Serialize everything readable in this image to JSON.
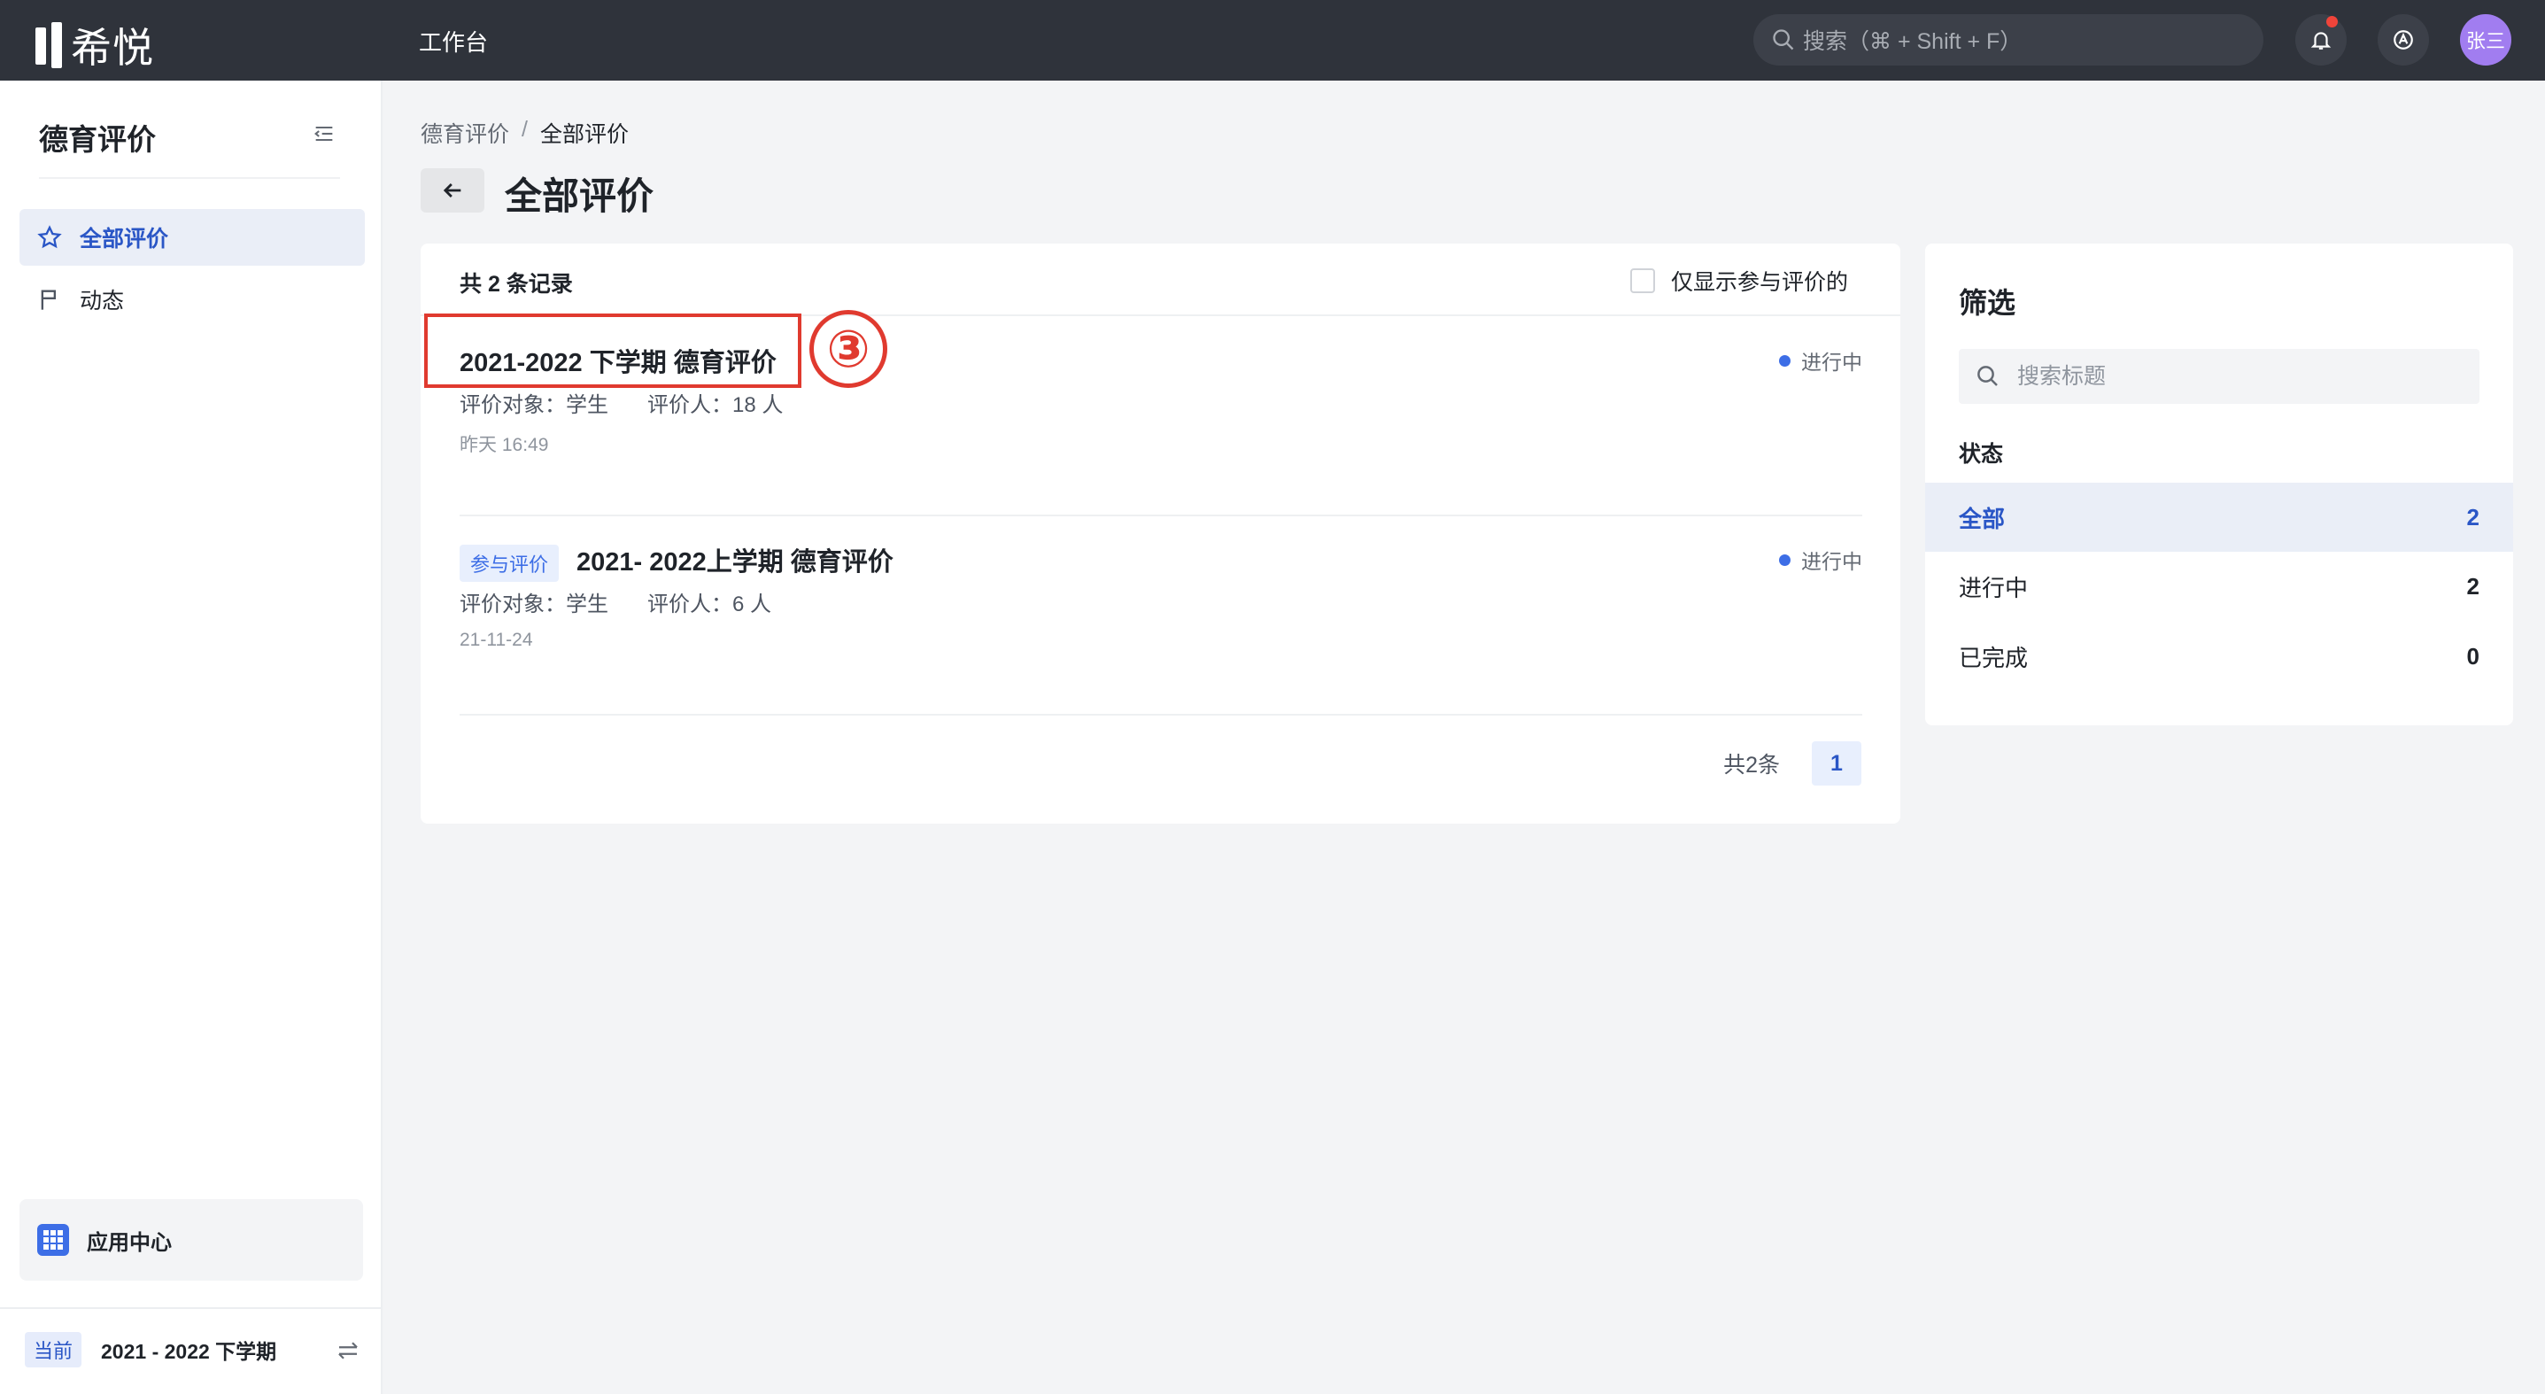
{
  "app": {
    "logo_text": "希悦",
    "nav_title": "工作台"
  },
  "topbar": {
    "search_placeholder": "搜索（⌘ + Shift + F）",
    "avatar_text": "张三"
  },
  "sidebar": {
    "title": "德育评价",
    "items": [
      {
        "label": "全部评价",
        "icon": "star-icon",
        "active": true
      },
      {
        "label": "动态",
        "icon": "flag-icon",
        "active": false
      }
    ],
    "app_center_label": "应用中心",
    "term_tag": "当前",
    "term_text": "2021 - 2022 下学期"
  },
  "breadcrumb": {
    "root": "德育评价",
    "separator": "/",
    "current": "全部评价"
  },
  "page_title": "全部评价",
  "list": {
    "record_count": "共 2 条记录",
    "only_mine_label": "仅显示参与评价的",
    "items": [
      {
        "title": "2021-2022 下学期 德育评价",
        "status": "进行中",
        "target": "评价对象：学生",
        "raters": "评价人：18 人",
        "time": "昨天 16:49",
        "annotation": "③"
      },
      {
        "tag": "参与评价",
        "title": "2021- 2022上学期 德育评价",
        "status": "进行中",
        "target": "评价对象：学生",
        "raters": "评价人：6 人",
        "time": "21-11-24"
      }
    ],
    "pager_total": "共2条",
    "current_page": "1"
  },
  "filter": {
    "title": "筛选",
    "search_placeholder": "搜索标题",
    "status_heading": "状态",
    "rows": [
      {
        "name": "全部",
        "count": "2",
        "active": true
      },
      {
        "name": "进行中",
        "count": "2",
        "active": false
      },
      {
        "name": "已完成",
        "count": "0",
        "active": false
      }
    ]
  },
  "colors": {
    "topbar": "#2f333b",
    "accent": "#2a56c6",
    "status_dot": "#3d6ee6",
    "annotation_red": "#e03a2f",
    "avatar": "#a17df0"
  }
}
